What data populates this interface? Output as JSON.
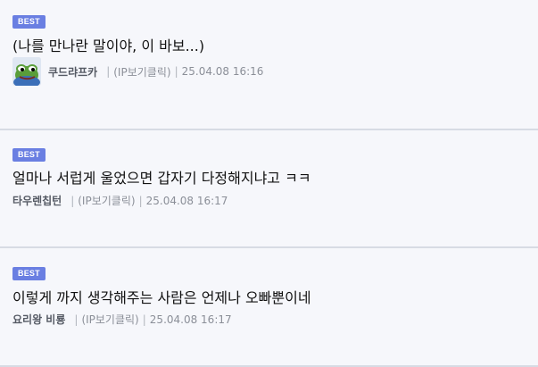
{
  "badge_label": "BEST",
  "comments": [
    {
      "author": "쿠드랴프카",
      "text": "(나를 만나란 말이야, 이 바보...)",
      "ip_label": "(IP보기클릭)",
      "timestamp": "25.04.08 16:16",
      "avatar": "frog-avatar"
    },
    {
      "author": "타우렌칩턴",
      "text": "얼마나 서럽게 울었으면 갑자기 다정해지냐고 ㅋㅋ",
      "ip_label": "(IP보기클릭)",
      "timestamp": "25.04.08 16:17"
    },
    {
      "author": "요리왕 비룡",
      "text": "이렇게 까지 생각해주는 사람은 언제나 오빠뿐이네",
      "ip_label": "(IP보기클릭)",
      "timestamp": "25.04.08 16:17"
    }
  ],
  "colors": {
    "badge_background": "#6a7fe2",
    "page_background": "#f6f7fb",
    "divider": "#d7dbe4"
  }
}
